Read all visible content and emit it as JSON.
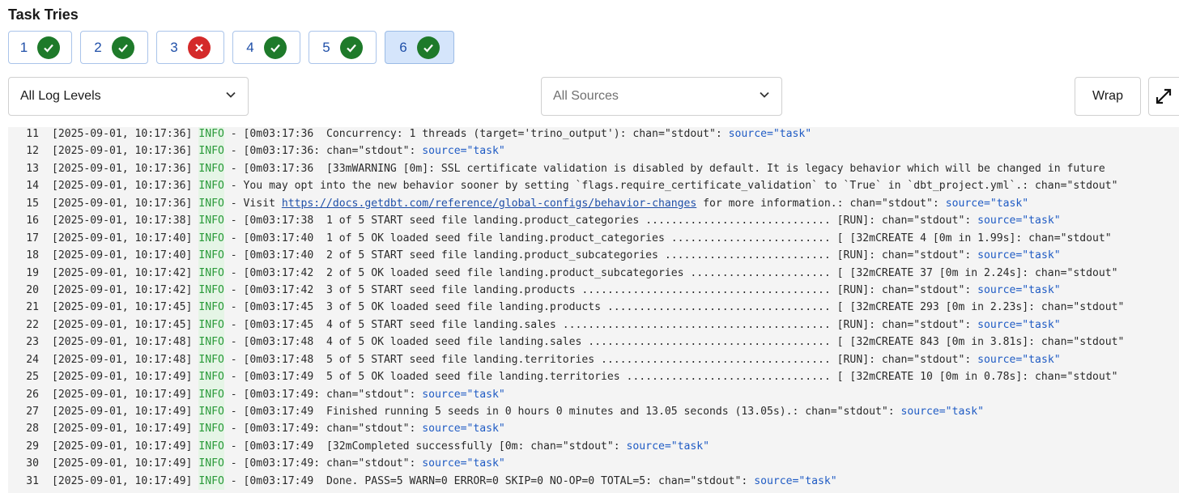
{
  "title": "Task Tries",
  "tries": [
    {
      "num": "1",
      "status": "success"
    },
    {
      "num": "2",
      "status": "success"
    },
    {
      "num": "3",
      "status": "failed"
    },
    {
      "num": "4",
      "status": "success"
    },
    {
      "num": "5",
      "status": "success"
    },
    {
      "num": "6",
      "status": "success",
      "selected": true
    }
  ],
  "filters": {
    "log_level": "All Log Levels",
    "sources_placeholder": "All Sources"
  },
  "toolbar": {
    "wrap_label": "Wrap"
  },
  "colors": {
    "success": "#1e7a2a",
    "failed": "#d42a2a",
    "info": "#2a9a3a",
    "source": "#1f5bc4",
    "selected_bg": "#d5e5fb"
  },
  "log": {
    "lines": [
      {
        "n": "11",
        "ts": "[2025-09-01, 10:17:36]",
        "level": "INFO",
        "msg": " [0m03:17:36  Concurrency: 1 threads (target='trino_output'): chan=\"stdout\": ",
        "src": "source=\"task\""
      },
      {
        "n": "12",
        "ts": "[2025-09-01, 10:17:36]",
        "level": "INFO",
        "msg": " [0m03:17:36: chan=\"stdout\": ",
        "src": "source=\"task\""
      },
      {
        "n": "13",
        "ts": "[2025-09-01, 10:17:36]",
        "level": "INFO",
        "msg": " [0m03:17:36  [33mWARNING [0m]: SSL certificate validation is disabled by default. It is legacy behavior which will be changed in future",
        "src": ""
      },
      {
        "n": "14",
        "ts": "[2025-09-01, 10:17:36]",
        "level": "INFO",
        "msg": " You may opt into the new behavior sooner by setting `flags.require_certificate_validation` to `True` in `dbt_project.yml`.: chan=\"stdout\"",
        "src": ""
      },
      {
        "n": "15",
        "ts": "[2025-09-01, 10:17:36]",
        "level": "INFO",
        "msg": " Visit ",
        "link": "https://docs.getdbt.com/reference/global-configs/behavior-changes",
        "msg2": " for more information.: chan=\"stdout\": ",
        "src": "source=\"task\""
      },
      {
        "n": "16",
        "ts": "[2025-09-01, 10:17:38]",
        "level": "INFO",
        "msg": " [0m03:17:38  1 of 5 START seed file landing.product_categories ............................. [RUN]: chan=\"stdout\": ",
        "src": "source=\"task\""
      },
      {
        "n": "17",
        "ts": "[2025-09-01, 10:17:40]",
        "level": "INFO",
        "msg": " [0m03:17:40  1 of 5 OK loaded seed file landing.product_categories ......................... [ [32mCREATE 4 [0m in 1.99s]: chan=\"stdout\"",
        "src": ""
      },
      {
        "n": "18",
        "ts": "[2025-09-01, 10:17:40]",
        "level": "INFO",
        "msg": " [0m03:17:40  2 of 5 START seed file landing.product_subcategories .......................... [RUN]: chan=\"stdout\": ",
        "src": "source=\"task\""
      },
      {
        "n": "19",
        "ts": "[2025-09-01, 10:17:42]",
        "level": "INFO",
        "msg": " [0m03:17:42  2 of 5 OK loaded seed file landing.product_subcategories ...................... [ [32mCREATE 37 [0m in 2.24s]: chan=\"stdout\"",
        "src": ""
      },
      {
        "n": "20",
        "ts": "[2025-09-01, 10:17:42]",
        "level": "INFO",
        "msg": " [0m03:17:42  3 of 5 START seed file landing.products ....................................... [RUN]: chan=\"stdout\": ",
        "src": "source=\"task\""
      },
      {
        "n": "21",
        "ts": "[2025-09-01, 10:17:45]",
        "level": "INFO",
        "msg": " [0m03:17:45  3 of 5 OK loaded seed file landing.products ................................... [ [32mCREATE 293 [0m in 2.23s]: chan=\"stdout\"",
        "src": ""
      },
      {
        "n": "22",
        "ts": "[2025-09-01, 10:17:45]",
        "level": "INFO",
        "msg": " [0m03:17:45  4 of 5 START seed file landing.sales .......................................... [RUN]: chan=\"stdout\": ",
        "src": "source=\"task\""
      },
      {
        "n": "23",
        "ts": "[2025-09-01, 10:17:48]",
        "level": "INFO",
        "msg": " [0m03:17:48  4 of 5 OK loaded seed file landing.sales ...................................... [ [32mCREATE 843 [0m in 3.81s]: chan=\"stdout\"",
        "src": ""
      },
      {
        "n": "24",
        "ts": "[2025-09-01, 10:17:48]",
        "level": "INFO",
        "msg": " [0m03:17:48  5 of 5 START seed file landing.territories .................................... [RUN]: chan=\"stdout\": ",
        "src": "source=\"task\""
      },
      {
        "n": "25",
        "ts": "[2025-09-01, 10:17:49]",
        "level": "INFO",
        "msg": " [0m03:17:49  5 of 5 OK loaded seed file landing.territories ................................ [ [32mCREATE 10 [0m in 0.78s]: chan=\"stdout\"",
        "src": ""
      },
      {
        "n": "26",
        "ts": "[2025-09-01, 10:17:49]",
        "level": "INFO",
        "msg": " [0m03:17:49: chan=\"stdout\": ",
        "src": "source=\"task\""
      },
      {
        "n": "27",
        "ts": "[2025-09-01, 10:17:49]",
        "level": "INFO",
        "msg": " [0m03:17:49  Finished running 5 seeds in 0 hours 0 minutes and 13.05 seconds (13.05s).: chan=\"stdout\": ",
        "src": "source=\"task\""
      },
      {
        "n": "28",
        "ts": "[2025-09-01, 10:17:49]",
        "level": "INFO",
        "msg": " [0m03:17:49: chan=\"stdout\": ",
        "src": "source=\"task\""
      },
      {
        "n": "29",
        "ts": "[2025-09-01, 10:17:49]",
        "level": "INFO",
        "msg": " [0m03:17:49  [32mCompleted successfully [0m: chan=\"stdout\": ",
        "src": "source=\"task\""
      },
      {
        "n": "30",
        "ts": "[2025-09-01, 10:17:49]",
        "level": "INFO",
        "msg": " [0m03:17:49: chan=\"stdout\": ",
        "src": "source=\"task\""
      },
      {
        "n": "31",
        "ts": "[2025-09-01, 10:17:49]",
        "level": "INFO",
        "msg": " [0m03:17:49  Done. PASS=5 WARN=0 ERROR=0 SKIP=0 NO-OP=0 TOTAL=5: chan=\"stdout\": ",
        "src": "source=\"task\""
      }
    ]
  }
}
